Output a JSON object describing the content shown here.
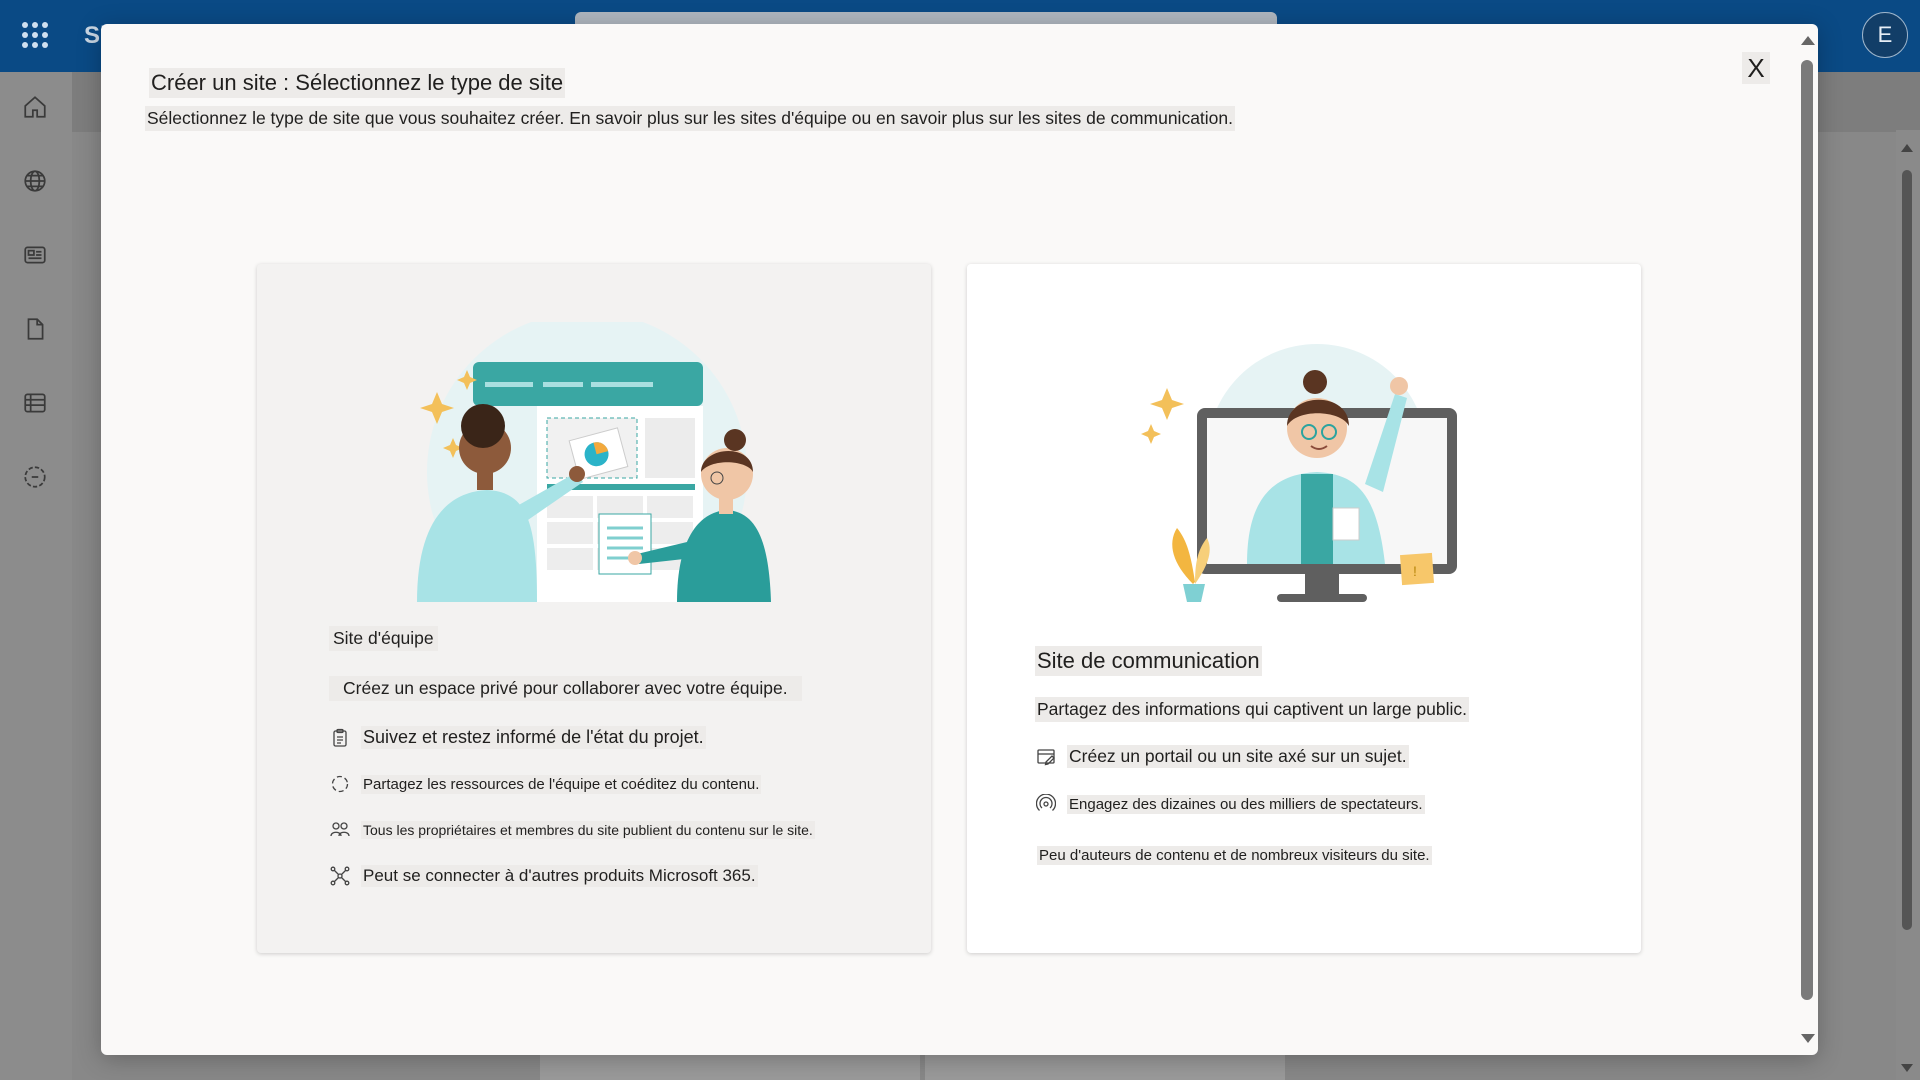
{
  "app": {
    "brand": "Sh",
    "avatar_initial": "E"
  },
  "rail": {
    "icons": [
      "home-icon",
      "globe-icon",
      "news-icon",
      "document-icon",
      "list-icon",
      "create-icon"
    ]
  },
  "dialog": {
    "title": "Créer un site : Sélectionnez le type de site",
    "subtitle": "Sélectionnez le type de site que vous souhaitez créer. En savoir plus sur les sites d'équipe ou en savoir plus sur les sites de communication.",
    "close_label": "X",
    "team_site": {
      "title": "Site d'équipe",
      "description": "Créez un espace privé pour collaborer avec votre équipe.",
      "features": [
        {
          "icon": "clipboard-icon",
          "text": "Suivez et restez informé de l'état du projet."
        },
        {
          "icon": "sync-circle-icon",
          "text": "Partagez les ressources de l'équipe et coéditez du contenu."
        },
        {
          "icon": "people-icon",
          "text": "Tous les propriétaires et membres du site publient du contenu sur le site."
        },
        {
          "icon": "connect-icon",
          "text": "Peut se connecter à d'autres produits Microsoft 365."
        }
      ]
    },
    "communication_site": {
      "title": "Site de communication",
      "description": "Partagez des informations qui captivent un large public.",
      "features": [
        {
          "icon": "edit-page-icon",
          "text": "Créez un portail ou un site axé sur un sujet."
        },
        {
          "icon": "broadcast-icon",
          "text": "Engagez des dizaines ou des milliers de spectateurs."
        },
        {
          "icon": "",
          "text": "Peu d'auteurs de contenu et de nombreux visiteurs du site."
        }
      ]
    }
  },
  "colors": {
    "accent_teal": "#3aa7a3",
    "topbar": "#0a4a85",
    "star": "#f3c05a"
  }
}
